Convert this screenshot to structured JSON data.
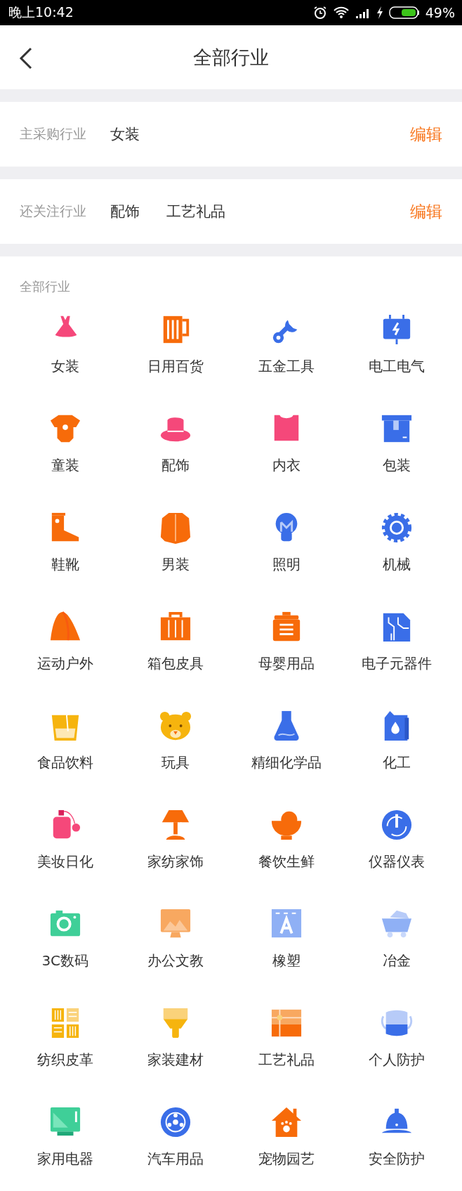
{
  "status_bar": {
    "time": "晚上10:42",
    "battery_percent": "49%"
  },
  "header": {
    "title": "全部行业"
  },
  "main_industry": {
    "label": "主采购行业",
    "values": [
      "女装"
    ],
    "action": "编辑"
  },
  "followed_industries": {
    "label": "还关注行业",
    "values": [
      "配饰",
      "工艺礼品"
    ],
    "action": "编辑"
  },
  "all_industries": {
    "label": "全部行业",
    "items": [
      "女装",
      "日用百货",
      "五金工具",
      "电工电气",
      "童装",
      "配饰",
      "内衣",
      "包装",
      "鞋靴",
      "男装",
      "照明",
      "机械",
      "运动户外",
      "箱包皮具",
      "母婴用品",
      "电子元器件",
      "食品饮料",
      "玩具",
      "精细化学品",
      "化工",
      "美妆日化",
      "家纺家饰",
      "餐饮生鲜",
      "仪器仪表",
      "3C数码",
      "办公文教",
      "橡塑",
      "冶金",
      "纺织皮革",
      "家装建材",
      "工艺礼品",
      "个人防护",
      "家用电器",
      "汽车用品",
      "宠物园艺",
      "安全防护"
    ]
  }
}
